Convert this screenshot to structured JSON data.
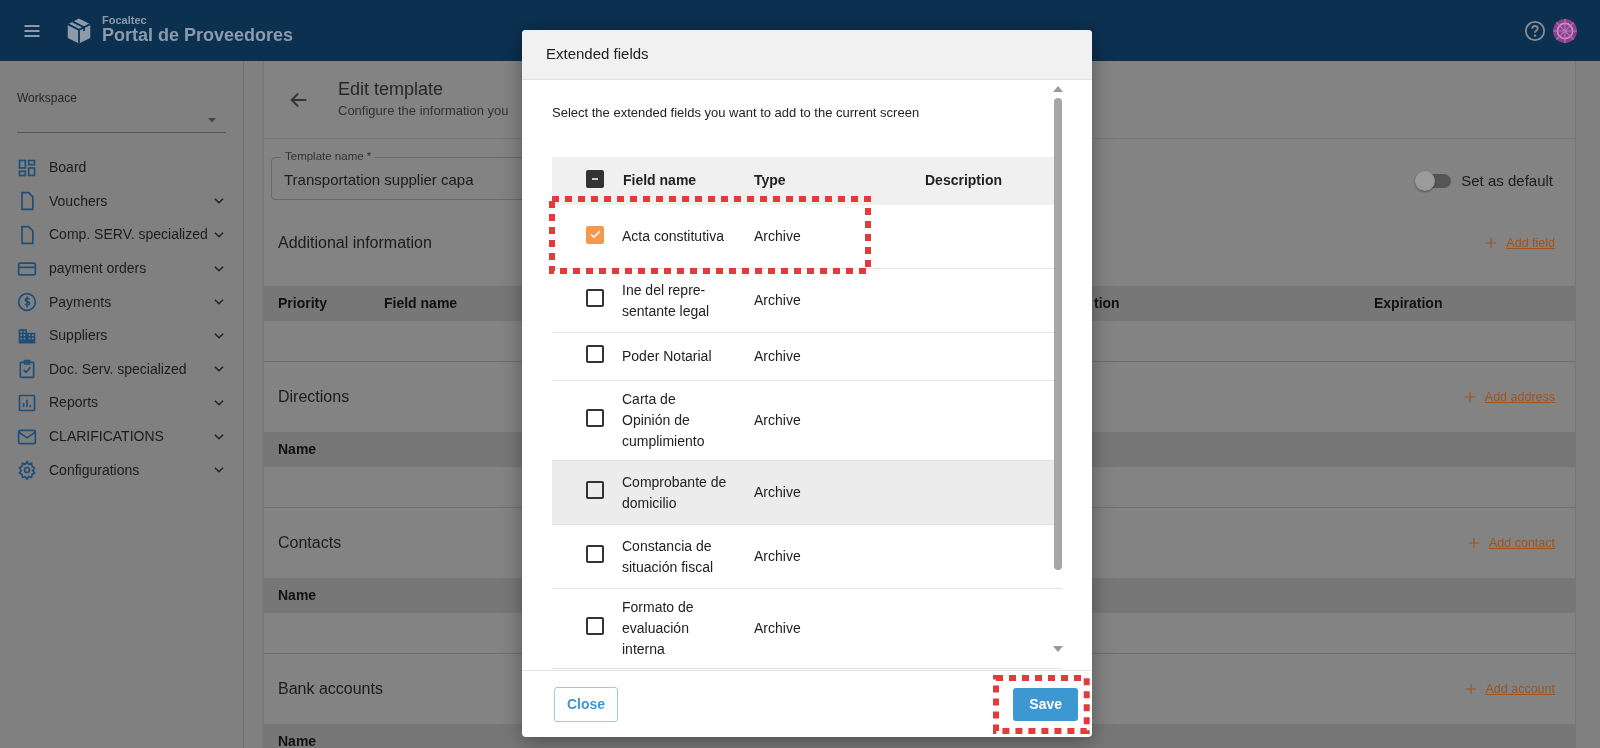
{
  "header": {
    "brand_small": "Focaltec",
    "brand": "Portal de Proveedores"
  },
  "sidebar": {
    "workspace_label": "Workspace",
    "items": [
      {
        "label": "Board",
        "kind": "grid",
        "expandable": false
      },
      {
        "label": "Vouchers",
        "kind": "file",
        "expandable": true
      },
      {
        "label": "Comp. SERV. specialized",
        "kind": "file",
        "expandable": true
      },
      {
        "label": "payment orders",
        "kind": "card",
        "expandable": true
      },
      {
        "label": "Payments",
        "kind": "dollar",
        "expandable": true
      },
      {
        "label": "Suppliers",
        "kind": "building",
        "expandable": true
      },
      {
        "label": "Doc. Serv. specialized",
        "kind": "clipboard",
        "expandable": true
      },
      {
        "label": "Reports",
        "kind": "chart",
        "expandable": true
      },
      {
        "label": "CLARIFICATIONS",
        "kind": "mail",
        "expandable": true
      },
      {
        "label": "Configurations",
        "kind": "gear",
        "expandable": true
      }
    ]
  },
  "page": {
    "title": "Edit template",
    "subtitle": "Configure the information you",
    "template_field": {
      "label": "Template name *",
      "value": "Transportation supplier capa"
    },
    "default_toggle": {
      "label": "Set as default",
      "on": false
    },
    "sections": [
      {
        "title": "Additional information",
        "action": "Add field",
        "columns": [
          "Priority",
          "Field name",
          "tion",
          "Expiration"
        ]
      },
      {
        "title": "Directions",
        "action": "Add address",
        "columns": [
          "Name"
        ]
      },
      {
        "title": "Contacts",
        "action": "Add contact",
        "columns": [
          "Name"
        ]
      },
      {
        "title": "Bank accounts",
        "action": "Add account",
        "columns": [
          "Name"
        ]
      }
    ]
  },
  "modal": {
    "title": "Extended fields",
    "instructions": "Select the extended fields you want to add to the current screen",
    "select_all_partial": true,
    "columns": [
      "Field name",
      "Type",
      "Description"
    ],
    "rows": [
      {
        "name": "Acta constitutiva",
        "type": "Archive",
        "checked": true,
        "hovered": false,
        "highlighted": true
      },
      {
        "name": "Ine del repre-sentante legal",
        "type": "Archive",
        "checked": false,
        "hovered": false,
        "highlighted": false
      },
      {
        "name": "Poder Notarial",
        "type": "Archive",
        "checked": false,
        "hovered": false,
        "highlighted": false
      },
      {
        "name": "Carta de Opinión de cumplimiento",
        "type": "Archive",
        "checked": false,
        "hovered": false,
        "highlighted": false
      },
      {
        "name": "Comprobante de domicilio",
        "type": "Archive",
        "checked": false,
        "hovered": true,
        "highlighted": false
      },
      {
        "name": "Constancia de situación fiscal",
        "type": "Archive",
        "checked": false,
        "hovered": false,
        "highlighted": false
      },
      {
        "name": "Formato de evaluación interna",
        "type": "Archive",
        "checked": false,
        "hovered": false,
        "highlighted": false
      }
    ],
    "close_button": "Close",
    "save_button": {
      "label": "Save",
      "highlighted": true
    }
  }
}
